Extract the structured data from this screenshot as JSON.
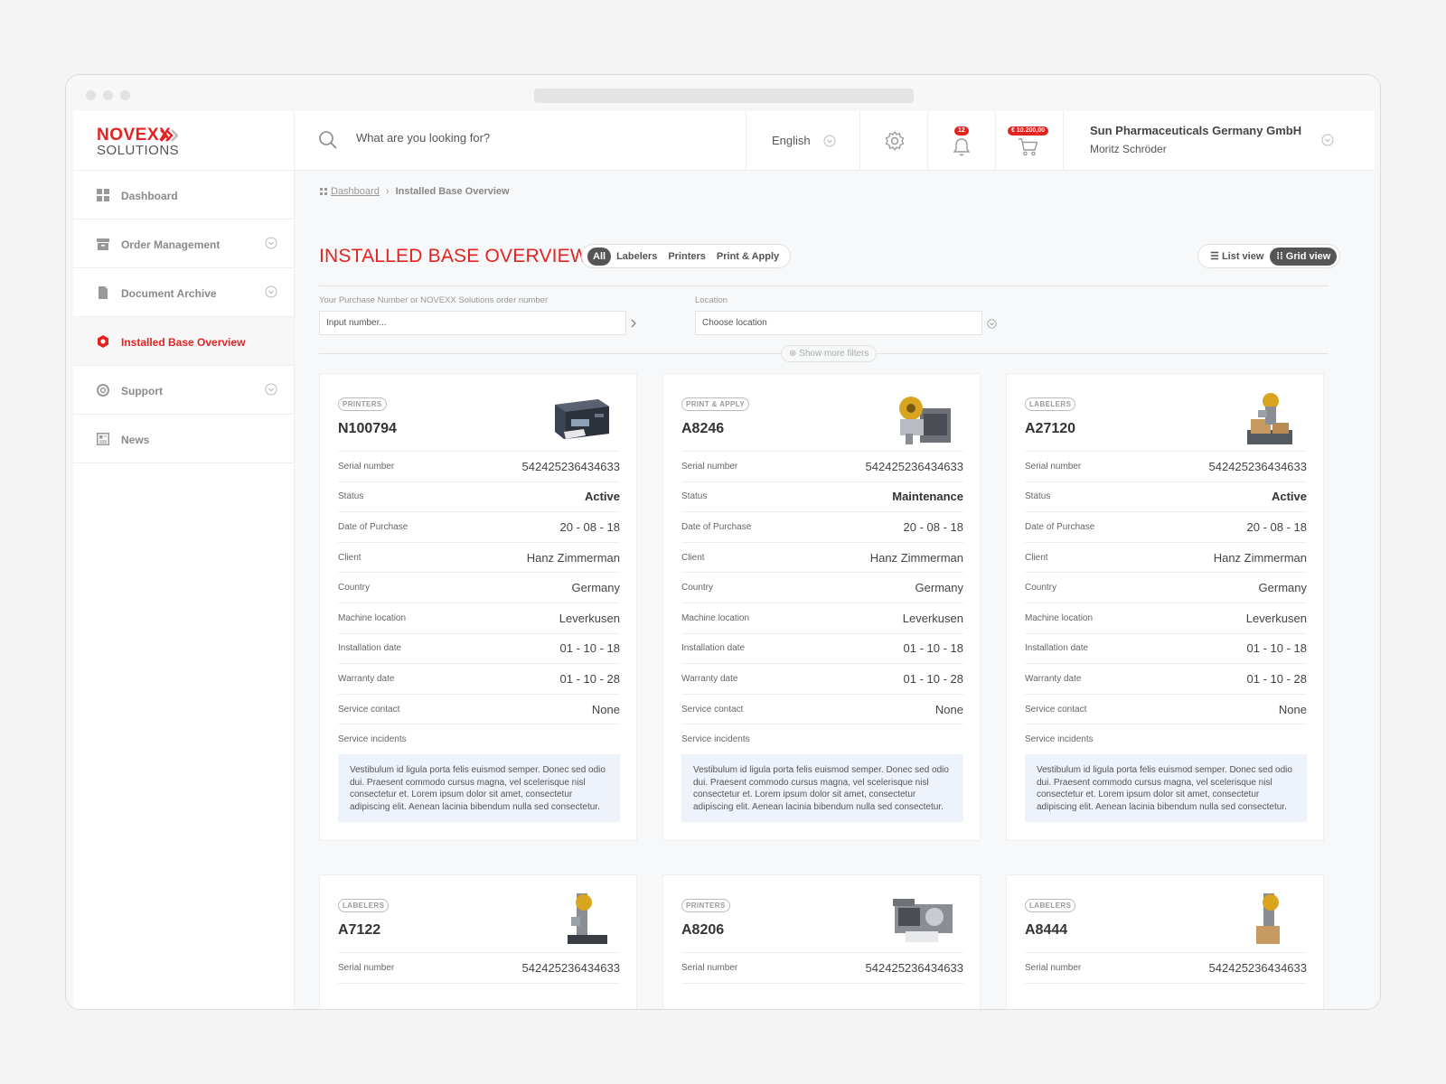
{
  "brand": {
    "name_top": "NOVEXX",
    "name_bottom": "SOLUTIONS",
    "accent": "#e42320"
  },
  "header": {
    "search_placeholder": "What are you looking for?",
    "language": "English",
    "notifications_count": "12",
    "cart_total": "€ 10.200,00",
    "company": "Sun Pharmaceuticals Germany GmbH",
    "user": "Moritz Schröder"
  },
  "sidebar": {
    "items": [
      {
        "label": "Dashboard",
        "icon": "grid-icon",
        "expandable": false,
        "active": false
      },
      {
        "label": "Order Management",
        "icon": "box-icon",
        "expandable": true,
        "active": false
      },
      {
        "label": "Document Archive",
        "icon": "document-icon",
        "expandable": true,
        "active": false
      },
      {
        "label": "Installed Base Overview",
        "icon": "hexagon-icon",
        "expandable": false,
        "active": true
      },
      {
        "label": "Support",
        "icon": "lifebuoy-icon",
        "expandable": true,
        "active": false
      },
      {
        "label": "News",
        "icon": "newspaper-icon",
        "expandable": false,
        "active": false
      }
    ]
  },
  "breadcrumb": {
    "root": "Dashboard",
    "separator": "›",
    "current": "Installed Base Overview"
  },
  "page": {
    "title": "INSTALLED BASE OVERVIEW",
    "filter_tabs": [
      "All",
      "Labelers",
      "Printers",
      "Print & Apply"
    ],
    "active_tab": "All",
    "views": {
      "list": "List view",
      "grid": "Grid view",
      "active": "grid"
    },
    "order_field": {
      "label": "Your Purchase Number or NOVEXX Solutions order number",
      "placeholder": "Input number..."
    },
    "location_field": {
      "label": "Location",
      "placeholder": "Choose location"
    },
    "more_filters": "Show more filters"
  },
  "row_labels": [
    "Serial number",
    "Status",
    "Date of Purchase",
    "Client",
    "Country",
    "Machine location",
    "Installation date",
    "Warranty date",
    "Service contact",
    "Service incidents"
  ],
  "cards": [
    {
      "category": "PRINTERS",
      "id": "N100794",
      "image": "printer",
      "serial": "542425236434633",
      "status": "Active",
      "purchase": "20 - 08 - 18",
      "client": "Hanz Zimmerman",
      "country": "Germany",
      "location": "Leverkusen",
      "install": "01 - 10 - 18",
      "warranty": "01 - 10 - 28",
      "contact": "None",
      "incidents": "Vestibulum id ligula porta felis euismod semper. Donec sed odio dui. Praesent commodo cursus magna, vel scelerisque nisl consectetur et. Lorem ipsum dolor sit amet, consectetur adipiscing elit. Aenean lacinia bibendum nulla sed consectetur."
    },
    {
      "category": "PRINT & APPLY",
      "id": "A8246",
      "image": "print-apply",
      "serial": "542425236434633",
      "status": "Maintenance",
      "purchase": "20 - 08 - 18",
      "client": "Hanz Zimmerman",
      "country": "Germany",
      "location": "Leverkusen",
      "install": "01 - 10 - 18",
      "warranty": "01 - 10 - 28",
      "contact": "None",
      "incidents": "Vestibulum id ligula porta felis euismod semper. Donec sed odio dui. Praesent commodo cursus magna, vel scelerisque nisl consectetur et. Lorem ipsum dolor sit amet, consectetur adipiscing elit. Aenean lacinia bibendum nulla sed consectetur."
    },
    {
      "category": "LABELERS",
      "id": "A27120",
      "image": "labeler",
      "serial": "542425236434633",
      "status": "Active",
      "purchase": "20 - 08 - 18",
      "client": "Hanz Zimmerman",
      "country": "Germany",
      "location": "Leverkusen",
      "install": "01 - 10 - 18",
      "warranty": "01 - 10 - 28",
      "contact": "None",
      "incidents": "Vestibulum id ligula porta felis euismod semper. Donec sed odio dui. Praesent commodo cursus magna, vel scelerisque nisl consectetur et. Lorem ipsum dolor sit amet, consectetur adipiscing elit. Aenean lacinia bibendum nulla sed consectetur."
    },
    {
      "category": "LABELERS",
      "id": "A7122",
      "image": "labeler-tall",
      "serial": "542425236434633"
    },
    {
      "category": "PRINTERS",
      "id": "A8206",
      "image": "printer-open",
      "serial": "542425236434633"
    },
    {
      "category": "LABELERS",
      "id": "A8444",
      "image": "labeler-tall",
      "serial": "542425236434633"
    }
  ]
}
